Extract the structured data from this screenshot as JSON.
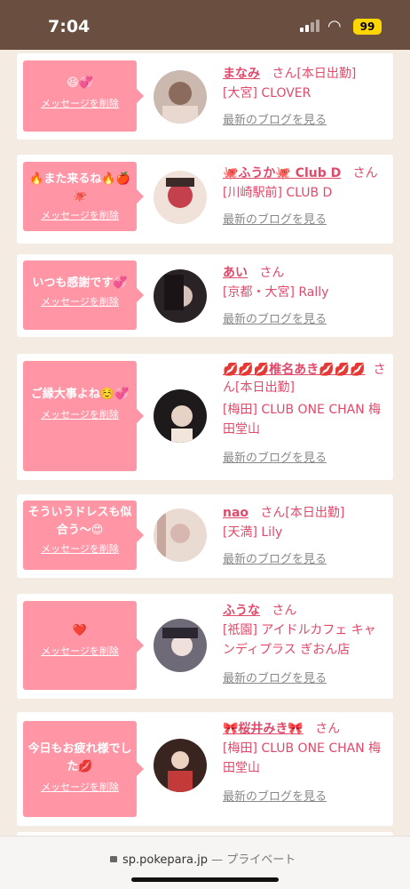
{
  "status": {
    "time": "7:04",
    "battery": "99"
  },
  "cards": [
    {
      "message": "😆💞",
      "delete": "メッセージを削除",
      "name": "まなみ",
      "san": "さん",
      "badge": "[本日出勤]",
      "shop": "[大宮] CLOVER",
      "blog": "最新のブログを見る",
      "avatar_color": "#8a6b5c"
    },
    {
      "message": "🔥また来るね🔥🍎🐙",
      "delete": "メッセージを削除",
      "name": "🐙ふうか🐙 Club D",
      "san": "さん",
      "badge": "",
      "shop": "[川崎駅前] CLUB D",
      "blog": "最新のブログを見る",
      "avatar_color": "#c4404c"
    },
    {
      "message": "いつも感謝です💞",
      "delete": "メッセージを削除",
      "name": "あい",
      "san": "さん",
      "badge": "",
      "shop": "[京都・大宮] Rally",
      "blog": "最新のブログを見る",
      "avatar_color": "#3a3030"
    },
    {
      "message": "ご縁大事よね☺️💞",
      "delete": "メッセージを削除",
      "name": "💋💋💋椎名あき💋💋💋",
      "san": "さん",
      "badge": "[本日出勤]",
      "shop": "[梅田] CLUB ONE CHAN 梅田堂山",
      "blog": "最新のブログを見る",
      "avatar_color": "#2c2628"
    },
    {
      "message": "そういうドレスも似合う〜😍",
      "delete": "メッセージを削除",
      "name": "nao",
      "san": "さん",
      "badge": "[本日出勤]",
      "shop": "[天満] Lily",
      "blog": "最新のブログを見る",
      "avatar_color": "#d8b7b0"
    },
    {
      "message": "❤️",
      "delete": "メッセージを削除",
      "name": "ふうな",
      "san": "さん",
      "badge": "",
      "shop": "[祇園] アイドルカフェ キャンディプラス ぎおん店",
      "blog": "最新のブログを見る",
      "avatar_color": "#5a4a52"
    },
    {
      "message": "今日もお疲れ様でした💋",
      "delete": "メッセージを削除",
      "name": "🎀桜井みき🎀",
      "san": "さん",
      "badge": "",
      "shop": "[梅田] CLUB ONE CHAN 梅田堂山",
      "blog": "最新のブログを見る",
      "avatar_color": "#c23a3a"
    }
  ],
  "urlbar": {
    "url": "sp.pokepara.jp",
    "sep": "—",
    "private": "プライベート"
  }
}
